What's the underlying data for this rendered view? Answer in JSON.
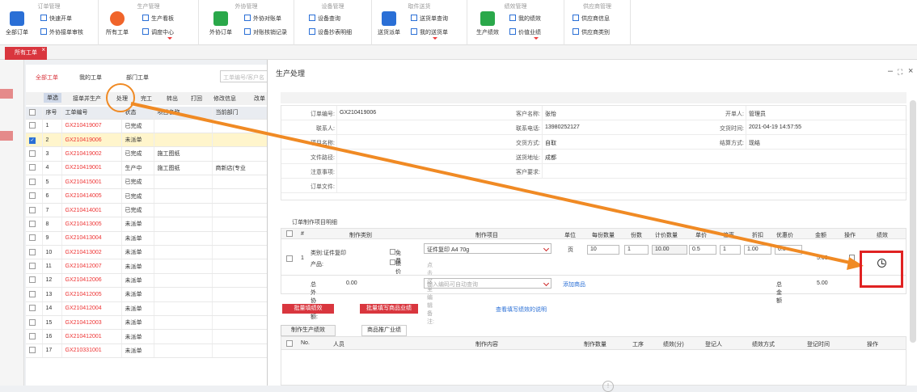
{
  "ribbon": {
    "groups": [
      {
        "title": "订单管理",
        "big": "全部订单",
        "items": [
          "快速开单",
          "外协接单审核"
        ]
      },
      {
        "title": "生产管理",
        "big": "所有工单",
        "items": [
          "生产看板",
          "调度中心"
        ]
      },
      {
        "title": "外协管理",
        "big": "外协订单",
        "items": [
          "外协对账单",
          "对账核销记录"
        ]
      },
      {
        "title": "设备管理",
        "items": [
          "设备查询",
          "设备抄表明细"
        ]
      },
      {
        "title": "取件送货",
        "big": "送货派单",
        "items": [
          "送货单查询",
          "我的送货单"
        ]
      },
      {
        "title": "绩效管理",
        "big": "生产绩效",
        "items": [
          "我的绩效",
          "价值业绩"
        ]
      },
      {
        "title": "供应商管理",
        "items": [
          "供应商信息",
          "供应商类别"
        ]
      }
    ]
  },
  "tabs": {
    "active": "所有工单"
  },
  "list": {
    "subtabs": [
      "全部工单",
      "我的工单",
      "部门工单"
    ],
    "search_placeholder": "工单编号/客户名",
    "toolbar": [
      "单选",
      "接单并生产",
      "处理",
      "完工",
      "转出",
      "打回",
      "修改信息",
      "改单"
    ],
    "headers": [
      "",
      "序号",
      "工单编号",
      "状态",
      "项目名称",
      "当前部门"
    ],
    "rows": [
      [
        "1",
        "GX210419007",
        "已完成",
        "",
        ""
      ],
      [
        "2",
        "GX210419006",
        "未派单",
        "",
        ""
      ],
      [
        "3",
        "GX210419002",
        "已完成",
        "施工图纸",
        ""
      ],
      [
        "4",
        "GX210419001",
        "生产中",
        "施工图纸",
        "商新店(专业"
      ],
      [
        "5",
        "GX210415001",
        "已完成",
        "",
        ""
      ],
      [
        "6",
        "GX210414005",
        "已完成",
        "",
        ""
      ],
      [
        "7",
        "GX210414001",
        "已完成",
        "",
        ""
      ],
      [
        "8",
        "GX210413005",
        "未派单",
        "",
        ""
      ],
      [
        "9",
        "GX210413004",
        "未派单",
        "",
        ""
      ],
      [
        "10",
        "GX210413002",
        "未派单",
        "",
        ""
      ],
      [
        "11",
        "GX210412007",
        "未派单",
        "",
        ""
      ],
      [
        "12",
        "GX210412006",
        "未派单",
        "",
        ""
      ],
      [
        "13",
        "GX210412005",
        "未派单",
        "",
        ""
      ],
      [
        "14",
        "GX210412004",
        "未派单",
        "",
        ""
      ],
      [
        "15",
        "GX210412003",
        "未派单",
        "",
        ""
      ],
      [
        "16",
        "GX210412001",
        "未派单",
        "",
        ""
      ],
      [
        "17",
        "GX210331001",
        "未派单",
        "",
        ""
      ]
    ]
  },
  "dialog": {
    "title": "生产处理",
    "info": {
      "order_no_label": "订单编号:",
      "order_no": "GX210419006",
      "customer_label": "客户名称:",
      "customer": "张怡",
      "creator_label": "开单人:",
      "creator": "管理员",
      "contact_label": "联系人:",
      "contact": "",
      "phone_label": "联系电话:",
      "phone": "13980252127",
      "delivery_time_label": "交货时间:",
      "delivery_time": "2021-04-19 14:57:55",
      "project_label": "项目名称:",
      "project": "",
      "delivery_mode_label": "交货方式:",
      "delivery_mode": "自取",
      "settle_label": "结算方式:",
      "settle": "现结",
      "path_label": "文件路径:",
      "path": "",
      "address_label": "送货地址:",
      "address": "成都",
      "note_label": "注意事项:",
      "note": "",
      "req_label": "客户要求:",
      "req": "",
      "file_label": "订单文件:",
      "file": ""
    },
    "items_title": "订单制作项目明细",
    "items_headers": [
      "#",
      "制作类别",
      "制作项目",
      "单位",
      "每份数量",
      "份数",
      "计价数量",
      "单价",
      "倍率",
      "折扣",
      "优惠价",
      "金额",
      "操作",
      "绩效"
    ],
    "item": {
      "index": "1",
      "category": "类别:证件复印",
      "product_label": "产品:",
      "free": "免费",
      "lock_price": "锁价",
      "project": "证件复印 A4 70g",
      "remark_placeholder": "点击这里编辑备注:",
      "unit": "页",
      "per_qty": "10",
      "copies": "1",
      "count_qty": "10.00",
      "price": "0.5",
      "rate": "1",
      "discount": "1.00",
      "promo": "0.5",
      "amount": "5.00"
    },
    "outsource_total_label": "总外协金额:",
    "outsource_total": "0.00",
    "search_goods_placeholder": "输入编码可自动查询",
    "add_goods": "添加商品",
    "total_label": "总金额",
    "total": "5.00",
    "batch_btn1": "批量填绩效",
    "batch_btn2": "批量填写商品业绩",
    "perf_help": "查看填写绩效的说明",
    "perf_tabs": [
      "制作生产绩效",
      "商品推广业绩"
    ],
    "perf_headers": [
      "No.",
      "人员",
      "制作内容",
      "制作数量",
      "工序",
      "绩效(分)",
      "登记人",
      "绩效方式",
      "登记时间",
      "操作"
    ]
  },
  "colors": {
    "accent": "#d9363e",
    "annotation": "#f08a24",
    "highlight_box": "#e02222"
  }
}
